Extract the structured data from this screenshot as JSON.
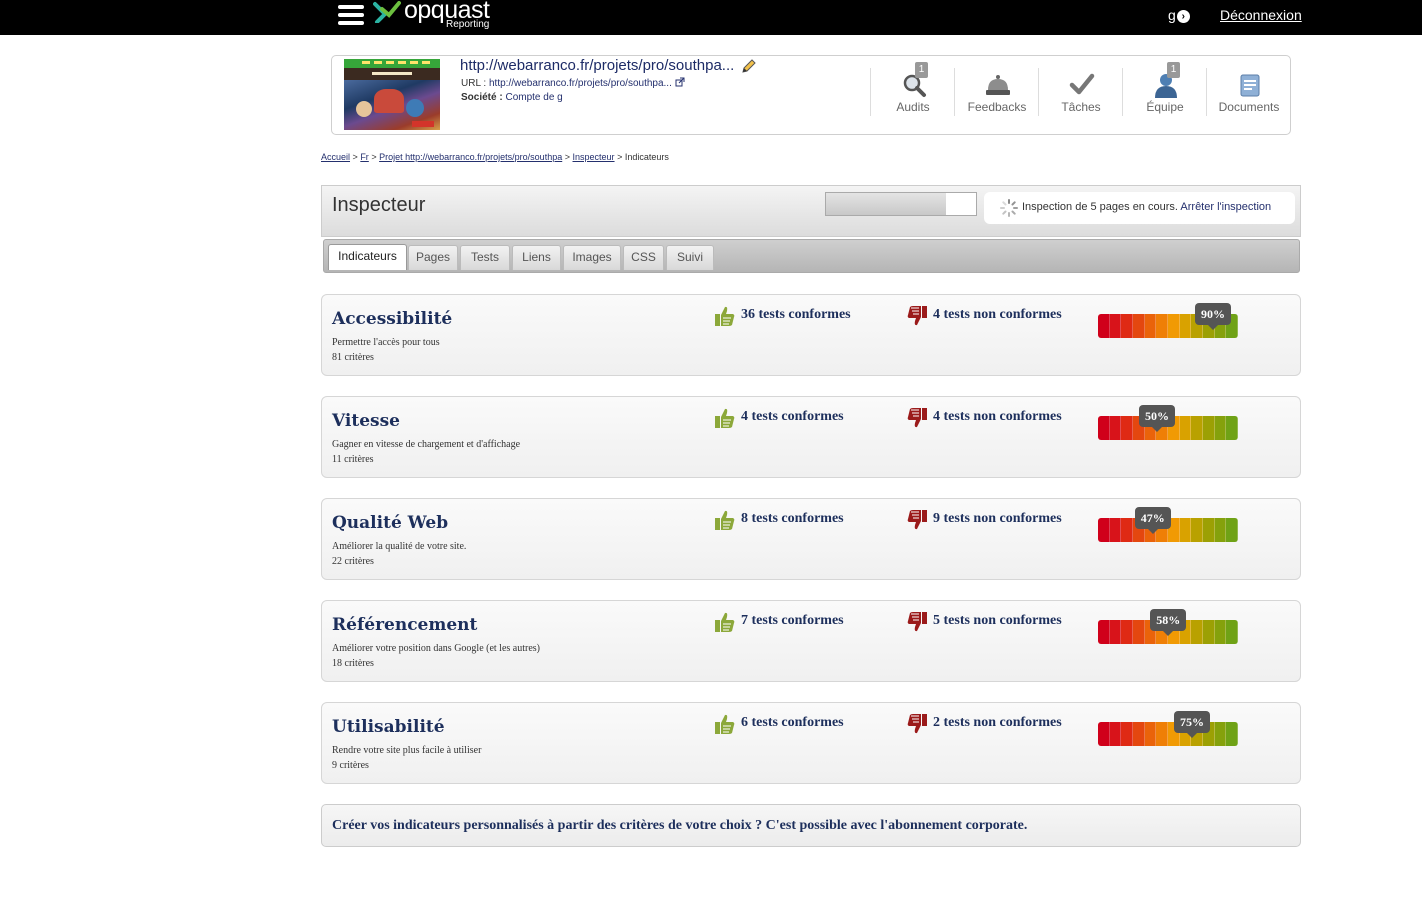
{
  "header": {
    "brand": "opquast",
    "brand_sub": "Reporting",
    "user": "g",
    "logout": "Déconnexion"
  },
  "project": {
    "title": "http://webarranco.fr/projets/pro/southpa...",
    "url_label": "URL :",
    "url_value": "http://webarranco.fr/projets/pro/southpa...",
    "company_label": "Société :",
    "company_value": "Compte de g",
    "tools": [
      {
        "label": "Audits",
        "icon": "magnifier-icon",
        "badge": "1"
      },
      {
        "label": "Feedbacks",
        "icon": "bell-icon",
        "badge": ""
      },
      {
        "label": "Tâches",
        "icon": "checkmark-icon",
        "badge": ""
      },
      {
        "label": "Équipe",
        "icon": "person-icon",
        "badge": "1"
      },
      {
        "label": "Documents",
        "icon": "document-icon",
        "badge": ""
      }
    ]
  },
  "breadcrumb": {
    "home": "Accueil",
    "sep": ">",
    "lang": "Fr",
    "project": "Projet http://webarranco.fr/projets/pro/southpa",
    "inspector": "Inspecteur",
    "current": "Indicateurs"
  },
  "inspector": {
    "title": "Inspecteur",
    "progress": 0.8,
    "status_text": "Inspection de 5 pages en cours.",
    "stop_label": "Arrêter l'inspection"
  },
  "tabs": [
    {
      "label": "Indicateurs",
      "active": true
    },
    {
      "label": "Pages",
      "active": false
    },
    {
      "label": "Tests",
      "active": false
    },
    {
      "label": "Liens",
      "active": false
    },
    {
      "label": "Images",
      "active": false
    },
    {
      "label": "CSS",
      "active": false
    },
    {
      "label": "Suivi",
      "active": false
    }
  ],
  "indicators": [
    {
      "name": "Accessibilité",
      "description": "Permettre l'accès pour tous",
      "criteria": "81 critères",
      "pass": "36 tests conformes",
      "fail": "4 tests non conformes",
      "score": 90,
      "score_label": "90%"
    },
    {
      "name": "Vitesse",
      "description": "Gagner en vitesse de chargement et d'affichage",
      "criteria": "11 critères",
      "pass": "4 tests conformes",
      "fail": "4 tests non conformes",
      "score": 50,
      "score_label": "50%"
    },
    {
      "name": "Qualité Web",
      "description": "Améliorer la qualité de votre site.",
      "criteria": "22 critères",
      "pass": "8 tests conformes",
      "fail": "9 tests non conformes",
      "score": 47,
      "score_label": "47%"
    },
    {
      "name": "Référencement",
      "description": "Améliorer votre position dans Google (et les autres)",
      "criteria": "18 critères",
      "pass": "7 tests conformes",
      "fail": "5 tests non conformes",
      "score": 58,
      "score_label": "58%"
    },
    {
      "name": "Utilisabilité",
      "description": "Rendre votre site plus facile à utiliser",
      "criteria": "9 critères",
      "pass": "6 tests conformes",
      "fail": "2 tests non conformes",
      "score": 75,
      "score_label": "75%"
    }
  ],
  "gauge_colors": [
    "#d0001a",
    "#d8131a",
    "#df2a14",
    "#e4470f",
    "#ea630a",
    "#ef7f06",
    "#f19a04",
    "#d9a200",
    "#b9a100",
    "#9ca004",
    "#85a10c",
    "#6fa216"
  ],
  "colors": {
    "thumb_up": "#8ca83a",
    "thumb_down": "#9b1b1b",
    "title": "#1d2f5c"
  },
  "footer": {
    "text": "Créer vos indicateurs personnalisés à partir des critères de votre choix ? C'est possible avec l'abonnement corporate."
  }
}
